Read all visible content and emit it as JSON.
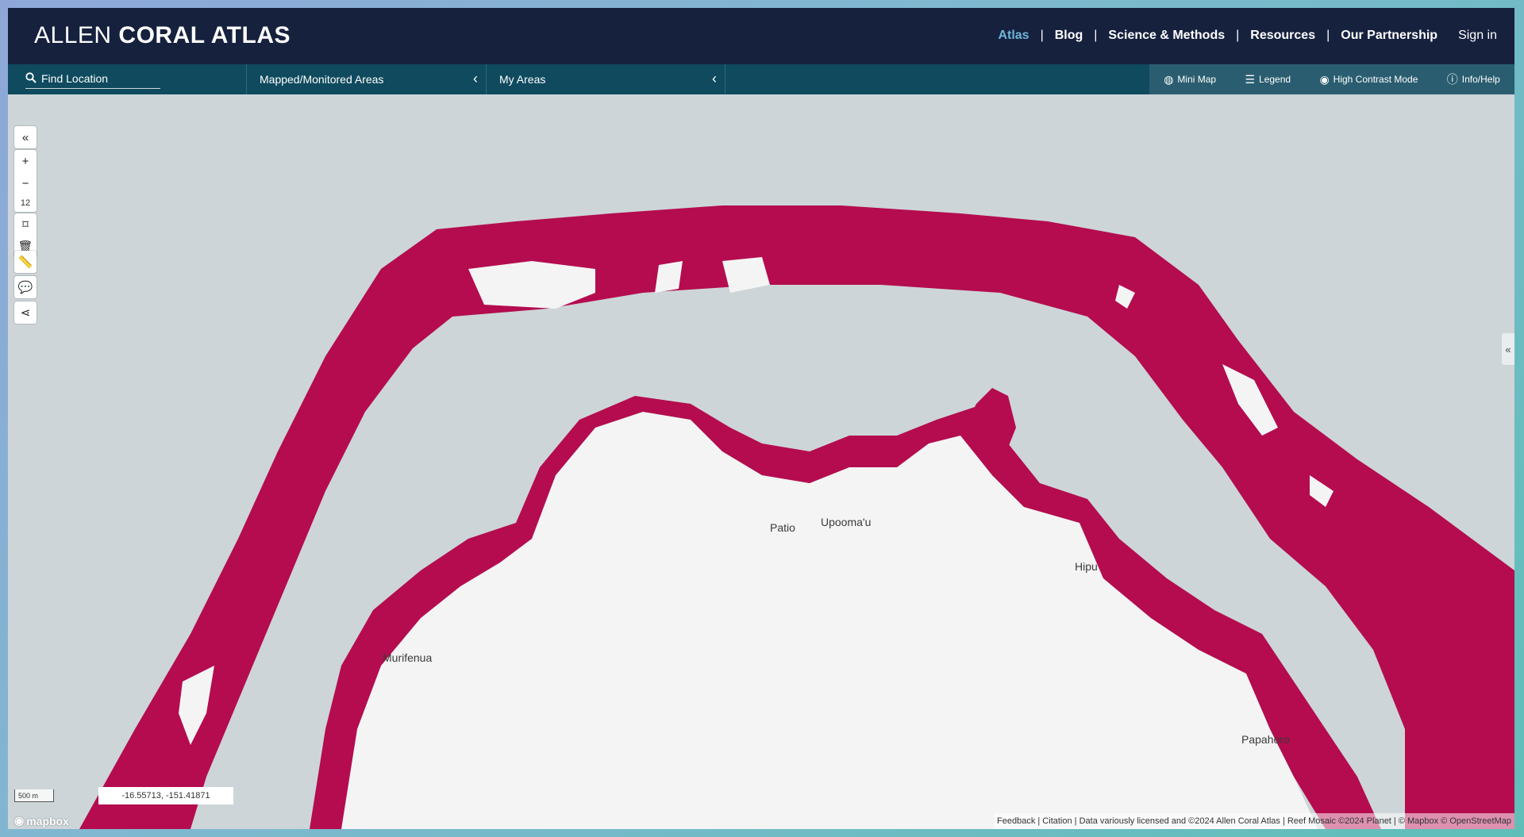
{
  "brand": {
    "light": "ALLEN",
    "bold": "CORAL ATLAS"
  },
  "nav": {
    "items": [
      "Atlas",
      "Blog",
      "Science & Methods",
      "Resources",
      "Our Partnership"
    ],
    "separator": "|",
    "signin": "Sign in"
  },
  "subbar": {
    "search_label": "Find Location",
    "mapped_areas": "Mapped/Monitored Areas",
    "my_areas": "My Areas",
    "right_tools": [
      "Mini Map",
      "Legend",
      "High Contrast Mode",
      "Info/Help"
    ]
  },
  "map_controls": {
    "collapse": "«",
    "zoom_in": "+",
    "zoom_out": "−",
    "zoom_level": "12",
    "right_collapse": "«"
  },
  "places": [
    "Patio",
    "Upooma'u",
    "Hipu",
    "Murifenua",
    "Papahoro"
  ],
  "scale": "500 m",
  "coords": "-16.55713, -151.41871",
  "mapbox": "mapbox",
  "attribution": "Feedback | Citation | Data variously licensed and ©2024 Allen Coral Atlas | Reef Mosaic ©2024 Planet | © Mapbox © OpenStreetMap",
  "colors": {
    "reef": "#b40c4f",
    "water": "#cdd5d8",
    "land": "#f4f4f4",
    "header": "#16213e",
    "subbar": "#0f4a5e",
    "active_nav": "#6fb6d6"
  }
}
